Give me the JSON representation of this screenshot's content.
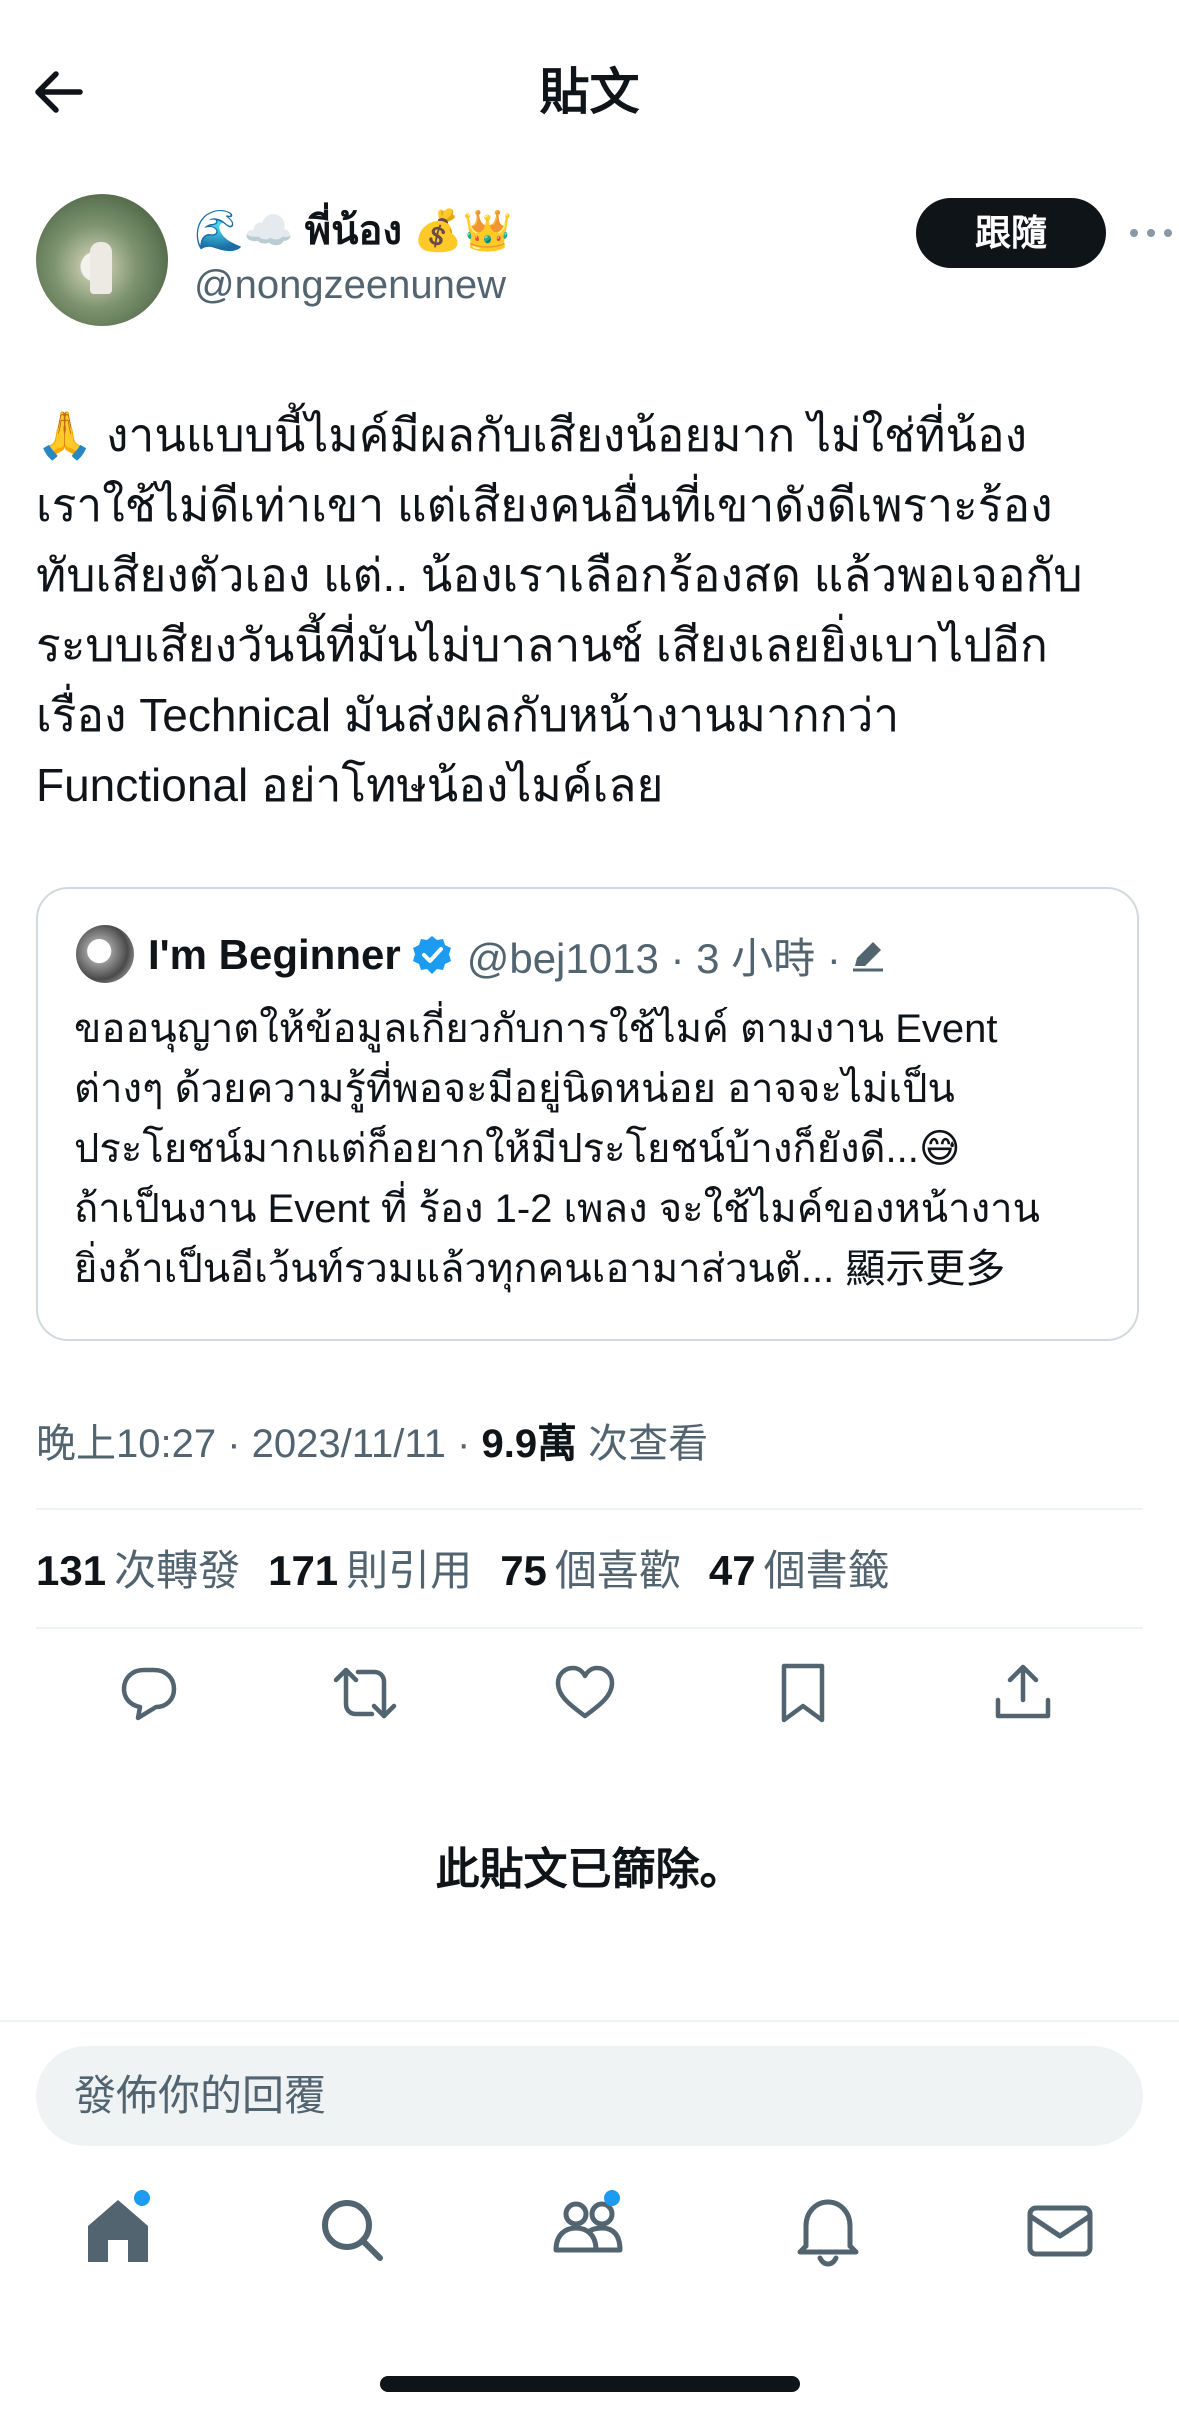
{
  "header": {
    "title": "貼文"
  },
  "author": {
    "display_name": "🌊☁️ พี่น้อง 💰👑",
    "handle": "@nongzeenunew",
    "follow_label": "跟隨"
  },
  "tweet": {
    "text": "🙏 งานแบบนี้ไมค์มีผลกับเสียงน้อยมาก ไม่ใช่ที่น้อง\nเราใช้ไม่ดีเท่าเขา แต่เสียงคนอื่นที่เขาดังดีเพราะร้อง\nทับเสียงตัวเอง แต่.. น้องเราเลือกร้องสด แล้วพอเจอกับ\nระบบเสียงวันนี้ที่มันไม่บาลานซ์ เสียงเลยยิ่งเบาไปอีก\nเรื่อง Technical มันส่งผลกับหน้างานมากกว่า\nFunctional อย่าโทษน้องไมค์เลย"
  },
  "quote": {
    "name": "I'm Beginner",
    "handle_time": "@bej1013 · 3 小時 ·",
    "text": "ขออนุญาตให้ข้อมูลเกี่ยวกับการใช้ไมค์ ตามงาน Event\nต่างๆ ด้วยความรู้ที่พอจะมีอยู่นิดหน่อย อาจจะไม่เป็น\nประโยชน์มากแต่ก็อยากให้มีประโยชน์บ้างก็ยังดี...😅\nถ้าเป็นงาน Event ที่ ร้อง 1-2 เพลง จะใช้ไมค์ของหน้างาน\nยิ่งถ้าเป็นอีเว้นท์รวมแล้วทุกคนเอามาส่วนตั... ",
    "show_more": "顯示更多"
  },
  "meta": {
    "timestamp": "晚上10:27 · 2023/11/11 · ",
    "views_count": "9.9萬",
    "views_label": " 次查看"
  },
  "stats": [
    {
      "count": "131",
      "label": "次轉發"
    },
    {
      "count": "171",
      "label": "則引用"
    },
    {
      "count": "75",
      "label": "個喜歡"
    },
    {
      "count": "47",
      "label": "個書籤"
    }
  ],
  "deleted_notice": "此貼文已篩除。",
  "reply": {
    "placeholder": "發佈你的回覆"
  },
  "colors": {
    "accent": "#1d9bf0",
    "text": "#0f1419",
    "muted": "#536471",
    "border": "#cfd9de"
  },
  "icons": {
    "back": "arrow-left-icon",
    "more": "more-horizontal-icon",
    "verified": "verified-badge-icon",
    "edit": "edited-icon",
    "actions": [
      "reply-icon",
      "retweet-icon",
      "like-icon",
      "bookmark-icon",
      "share-icon"
    ],
    "tabs": [
      "home-icon",
      "search-icon",
      "communities-icon",
      "notifications-icon",
      "messages-icon"
    ]
  }
}
